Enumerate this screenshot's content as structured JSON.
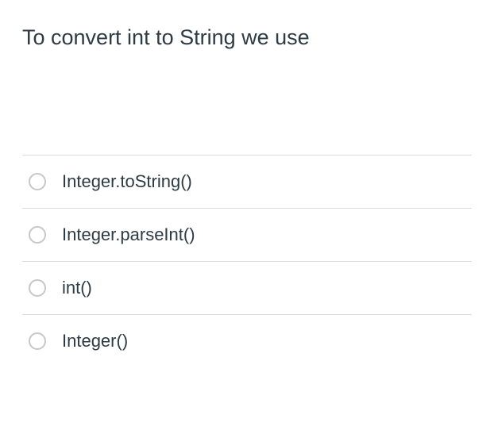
{
  "question": "To convert int to String we use",
  "options": [
    {
      "label": "Integer.toString()"
    },
    {
      "label": "Integer.parseInt()"
    },
    {
      "label": "int()"
    },
    {
      "label": "Integer()"
    }
  ]
}
